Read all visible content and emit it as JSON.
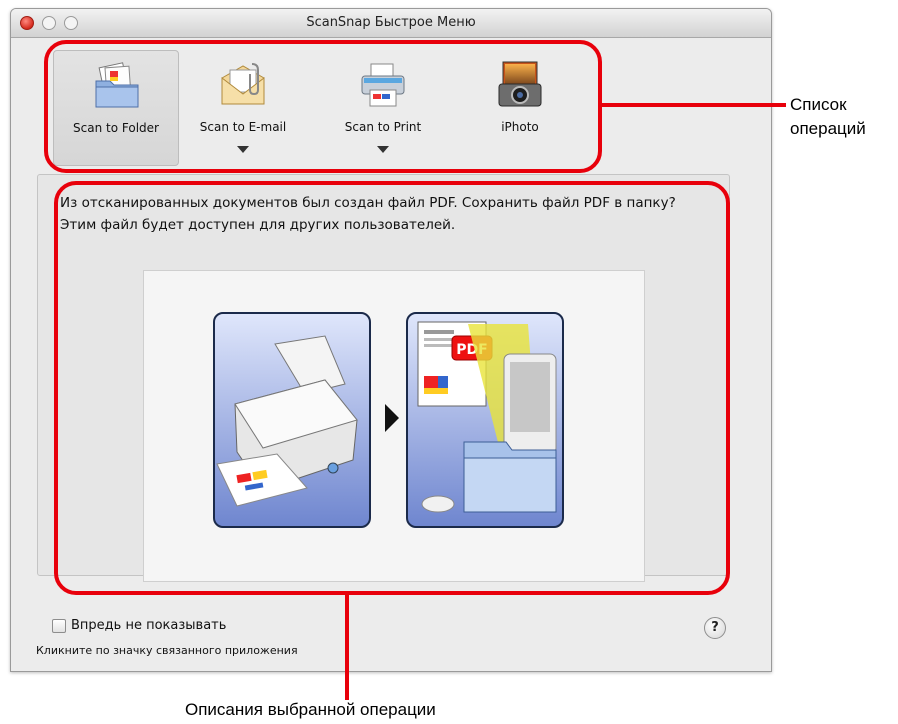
{
  "window": {
    "title": "ScanSnap Быстрое Меню"
  },
  "operations": [
    {
      "label": "Scan to Folder",
      "icon": "folder-icon",
      "selected": true,
      "has_menu": false
    },
    {
      "label": "Scan to E-mail",
      "icon": "envelope-icon",
      "selected": false,
      "has_menu": true
    },
    {
      "label": "Scan to Print",
      "icon": "printer-icon",
      "selected": false,
      "has_menu": true
    },
    {
      "label": "iPhoto",
      "icon": "camera-icon",
      "selected": false,
      "has_menu": false
    }
  ],
  "description": {
    "text": "Из отсканированных документов был создан файл PDF. Сохранить файл PDF в папку? Этим файл будет доступен для других пользователей."
  },
  "illustration": {
    "badge": "PDF"
  },
  "footer": {
    "checkbox_label": "Впредь не показывать",
    "checkbox_checked": false,
    "help_label": "?",
    "hint": "Кликните по значку связанного приложения"
  },
  "callouts": {
    "operations_list": "Список операций",
    "description": "Описания выбранной операции"
  },
  "colors": {
    "callout_red": "#e8000b",
    "selected_bg": "#d9d9d9",
    "card_blue": "#6f86cf"
  }
}
